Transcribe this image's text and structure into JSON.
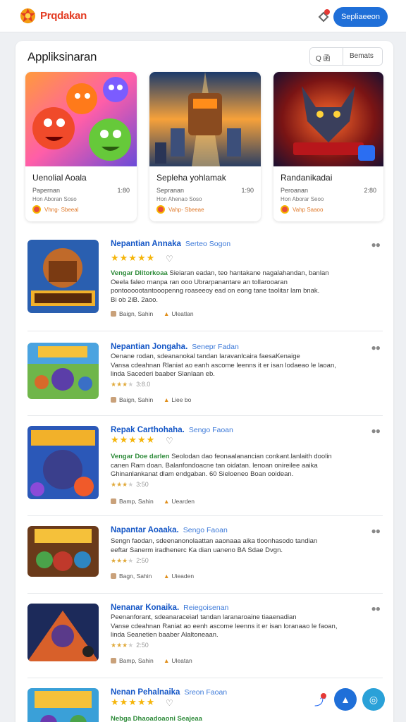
{
  "header": {
    "brand": "Prqdakan",
    "signin_label": "Sepliaeeon",
    "colors": {
      "brand": "#e33b22",
      "accent": "#1f6fd8"
    },
    "icons": [
      "logo-icon",
      "notification-icon"
    ]
  },
  "section": {
    "title": "Appliksinaran",
    "filter_label": "Q 函",
    "sort_label": "Bemats"
  },
  "featured": [
    {
      "title": "Uenolial Aoala",
      "line1": "Papernan",
      "num": "1:80",
      "line2": "Hon Aboran Soso",
      "line3": "Vhng- Sbeeal",
      "art": "cute-monsters-art"
    },
    {
      "title": "Sepleha yohlamak",
      "line1": "Sepranan",
      "num": "1:90",
      "line2": "Hon Ahenao Soso",
      "line3": "Vahp- Sbeeae",
      "art": "mech-warriors-art"
    },
    {
      "title": "Randanikadai",
      "line1": "Peroanan",
      "num": "2:80",
      "line2": "Hon Aborar Seoo",
      "line3": "Vahp Saaoo",
      "art": "demon-knight-art"
    }
  ],
  "items": [
    {
      "title": "Nepantian Annaka",
      "sub": "Serteo Sogon",
      "tag": "Vengar Dlitorkoaa",
      "lines": [
        "Sieiaran eadan, teo hantakane nagalahandan, banlan",
        "Oeela faleo rnanpa ran ooo Ubrarpanantare an tollarooaran",
        "pontoooootantooopenng roaseeoy ead on eong tane taolitar lam bnak.",
        "Bi ob 2iB. 2aoo."
      ],
      "meta1": "Baign, Sahin",
      "meta2": "Uleatlan",
      "full_stars": true,
      "rating": ""
    },
    {
      "title": "Nepantian Jongaha.",
      "sub": "Senepr Fadan",
      "tag": "",
      "lines": [
        "Oenane rodan, sdeananokal tandan laravanlcaira faesaKenaige",
        "Vansa cdeahnan Rlaniat ao eanh ascome leenns it er isan lodaeao le laoan,",
        "linda Sacederi baaber Slanlaan eb."
      ],
      "meta1": "Baign, Sahin",
      "meta2": "Liee bo",
      "full_stars": false,
      "rating": "3:8.0"
    },
    {
      "title": "Repak Carthohaha.",
      "sub": "Sengo Faoan",
      "tag": "Vengar Doe darlen",
      "lines": [
        "Seolodan dao feonaalanancian conkant.lanlaith doolin",
        "canen Ram doan. Balanfondoacne tan oidatan. lenoan onireilee aaika",
        "Ghinanlankanat dlam endgaban. 60 Sieloeneo Boan ooidean."
      ],
      "meta1": "Bamp, Sahin",
      "meta2": "Uearden",
      "full_stars": true,
      "rating": "3:50"
    },
    {
      "title": "Napantar Aoaaka.",
      "sub": "Sengo Faoan",
      "tag": "",
      "lines": [
        "Sengn faodan, sdeenanonolaattan aaonaaa aika tloonhasodo tandian",
        "eeftar Sanerm iradhenerc Ka dian uaneno BA Sdae Dvgn."
      ],
      "meta1": "Bagn, Sahin",
      "meta2": "Uieaden",
      "full_stars": false,
      "rating": "2:50"
    },
    {
      "title": "Nenanar Konaika.",
      "sub": "Reiegoisenan",
      "tag": "",
      "lines": [
        "Peenanforant, sdeanaraceiarl tandan laranaroaine tiaaenadian",
        "Vanse cdeahnan Raniat ao eenh ascome leenns it er isan loranaao le faoan,",
        "linda Seanetien baaber Alaltoneaan."
      ],
      "meta1": "Bamp, Sahin",
      "meta2": "Uleatan",
      "full_stars": false,
      "rating": "2:50"
    },
    {
      "title": "Nenan Pehalnaika",
      "sub": "Sreon Faoan",
      "tag": "Nebga Dhaoadoaoni Seajeaa",
      "lines": [],
      "meta1": "",
      "meta2": "",
      "full_stars": true,
      "rating": ""
    }
  ]
}
